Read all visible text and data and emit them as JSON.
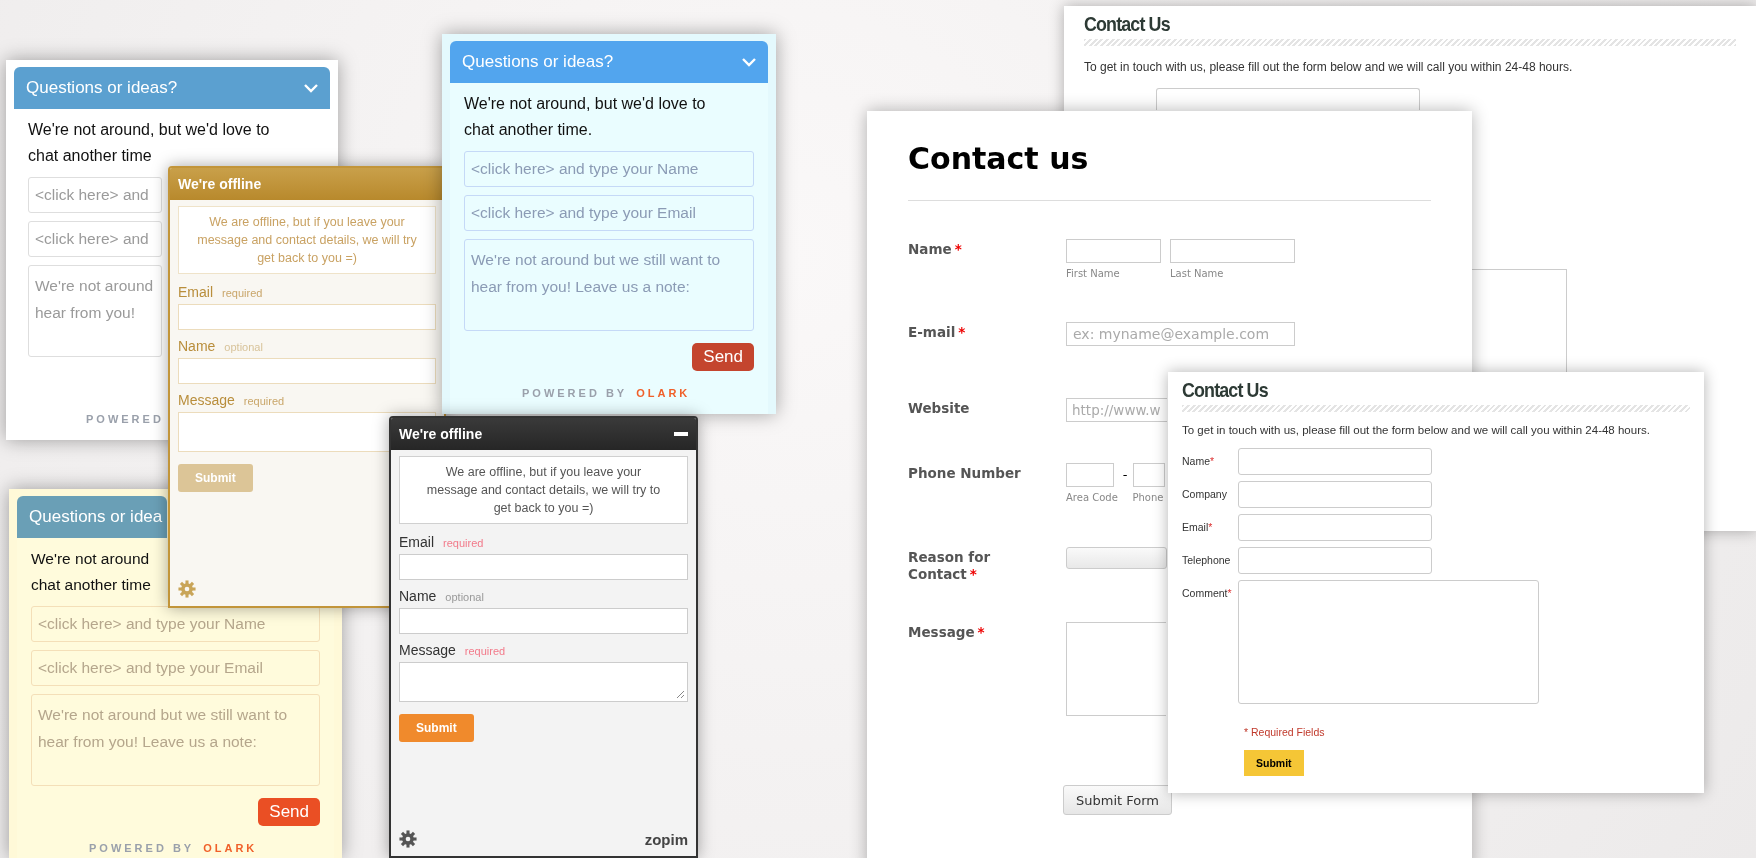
{
  "olark_widgets": [
    {
      "kind": "white",
      "title": "Questions or ideas?",
      "greeting_lines": [
        "We're not around, but we'd love to",
        "chat another time"
      ],
      "name_placeholder": "<click here> and",
      "email_placeholder": "<click here> and",
      "note_lines": [
        "We're not around",
        "hear from you!"
      ],
      "powered": "POWERED"
    },
    {
      "kind": "cyan",
      "title": "Questions or ideas?",
      "greeting_lines": [
        "We're not around, but we'd love to",
        "chat another time."
      ],
      "name_placeholder": "<click here> and type your Name",
      "email_placeholder": "<click here> and type your Email",
      "note_lines": [
        "We're not around but we still want to",
        "hear from you! Leave us a note:"
      ],
      "send": "Send",
      "powered": "POWERED BY",
      "brand": "OLARK"
    },
    {
      "kind": "yellow",
      "title": "Questions or idea",
      "greeting_lines": [
        "We're not around",
        "chat another time"
      ],
      "name_placeholder": "<click here> and type your Name",
      "email_placeholder": "<click here> and type your Email",
      "note_lines": [
        "We're not around but we still want to",
        "hear from you! Leave us a note:"
      ],
      "send": "Send",
      "powered": "POWERED BY",
      "brand": "OLARK"
    }
  ],
  "offline_widgets": [
    {
      "kind": "gold",
      "title": "We're offline",
      "notice_lines": [
        "We are offline, but if you leave your",
        "message and contact details, we will try",
        "get back to you =)"
      ],
      "fields": [
        {
          "label": "Email",
          "hint": "required",
          "required": true,
          "multiline": false
        },
        {
          "label": "Name",
          "hint": "optional",
          "required": false,
          "multiline": false
        },
        {
          "label": "Message",
          "hint": "required",
          "required": true,
          "multiline": true
        }
      ],
      "submit": "Submit"
    },
    {
      "kind": "dark",
      "title": "We're offline",
      "notice_lines": [
        "We are offline, but if you leave your",
        "message and contact details, we will try to",
        "get back to you =)"
      ],
      "fields": [
        {
          "label": "Email",
          "hint": "required",
          "required": true,
          "multiline": false
        },
        {
          "label": "Name",
          "hint": "optional",
          "required": false,
          "multiline": false
        },
        {
          "label": "Message",
          "hint": "required",
          "required": true,
          "multiline": true
        }
      ],
      "submit": "Submit",
      "brand": "zopim"
    }
  ],
  "contact_forms": [
    {
      "kind": "back",
      "title": "Contact Us",
      "intro": "To get in touch with us, please fill out the form below and we will call you within 24-48 hours."
    },
    {
      "kind": "main",
      "title": "Contact us",
      "required_mark": "*",
      "rows": [
        {
          "kind": "name",
          "label": "Name",
          "required": true,
          "subs": [
            "First Name",
            "Last Name"
          ]
        },
        {
          "kind": "email",
          "label": "E-mail",
          "required": true,
          "placeholder": "ex: myname@example.com"
        },
        {
          "kind": "website",
          "label": "Website",
          "required": false,
          "placeholder": "http://www.w"
        },
        {
          "kind": "phone",
          "label": "Phone Number",
          "required": false,
          "separator": "-",
          "subs": [
            "Area Code",
            "Phone"
          ]
        },
        {
          "kind": "select",
          "label": "Reason for Contact",
          "required": true
        },
        {
          "kind": "textarea",
          "label": "Message",
          "required": true
        }
      ],
      "submit": "Submit Form"
    },
    {
      "kind": "compact",
      "title": "Contact Us",
      "intro": "To get in touch with us, please fill out the form below and we will call you within 24-48 hours.",
      "required_mark": "*",
      "fields": [
        {
          "label": "Name",
          "required": true,
          "multiline": false
        },
        {
          "label": "Company",
          "required": false,
          "multiline": false
        },
        {
          "label": "Email",
          "required": true,
          "multiline": false
        },
        {
          "label": "Telephone",
          "required": false,
          "multiline": false
        },
        {
          "label": "Comment",
          "required": true,
          "multiline": true
        }
      ],
      "legend": "* Required Fields",
      "submit": "Submit"
    }
  ]
}
